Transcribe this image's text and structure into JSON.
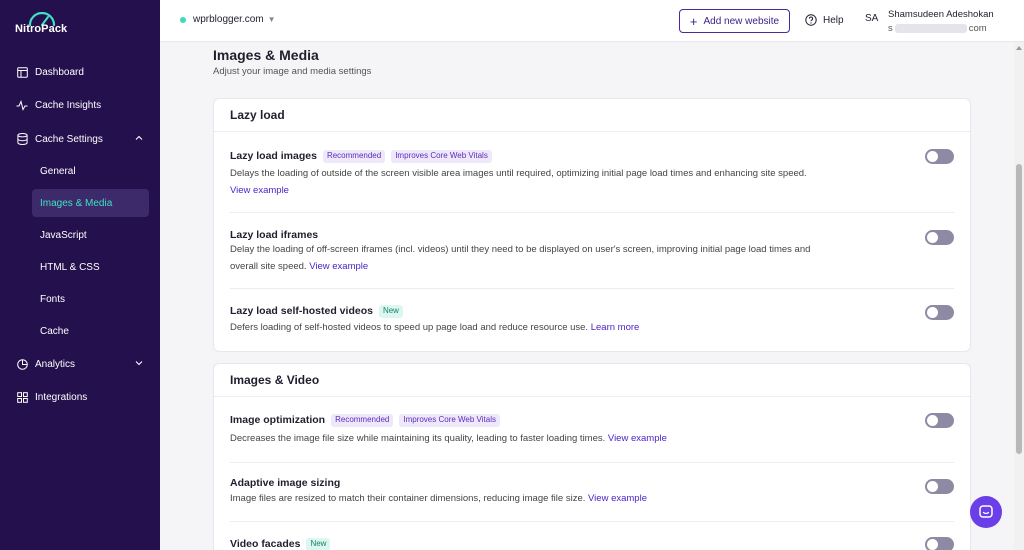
{
  "brand": {
    "name": "NitroPack"
  },
  "sidebar": {
    "items": [
      {
        "label": "Dashboard",
        "icon": "layout-icon"
      },
      {
        "label": "Cache Insights",
        "icon": "pulse-icon"
      },
      {
        "label": "Cache Settings",
        "icon": "database-icon"
      },
      {
        "label": "Analytics",
        "icon": "pie-chart-icon"
      },
      {
        "label": "Integrations",
        "icon": "grid-icon"
      }
    ],
    "sub_items": [
      "General",
      "Images & Media",
      "JavaScript",
      "HTML & CSS",
      "Fonts",
      "Cache"
    ],
    "active_sub": "Images & Media"
  },
  "header": {
    "site": "wprblogger.com",
    "add_button": "Add new website",
    "help": "Help",
    "avatar_initials": "SA",
    "user_name": "Shamsudeen Adeshokan",
    "user_email_start": "s",
    "user_email_end": "com"
  },
  "page": {
    "title": "Images & Media",
    "subtitle": "Adjust your image and media settings"
  },
  "sections": [
    {
      "title": "Lazy load",
      "rows": [
        {
          "title": "Lazy load images",
          "badges": [
            "Recommended",
            "Improves Core Web Vitals"
          ],
          "desc": "Delays the loading of outside of the screen visible area images until required, optimizing initial page load times and enhancing site speed.",
          "link": "View example",
          "enabled": false
        },
        {
          "title": "Lazy load iframes",
          "badges": [],
          "desc": "Delay the loading of off-screen iframes (incl. videos) until they need to be displayed on user's screen, improving initial page load times and overall site speed.",
          "link": "View example",
          "enabled": false
        },
        {
          "title": "Lazy load self-hosted videos",
          "badges": [
            "New"
          ],
          "desc": "Defers loading of self-hosted videos to speed up page load and reduce resource use.",
          "link": "Learn more",
          "enabled": false
        }
      ]
    },
    {
      "title": "Images & Video",
      "rows": [
        {
          "title": "Image optimization",
          "badges": [
            "Recommended",
            "Improves Core Web Vitals"
          ],
          "desc": "Decreases the image file size while maintaining its quality, leading to faster loading times.",
          "link": "View example",
          "enabled": false
        },
        {
          "title": "Adaptive image sizing",
          "badges": [],
          "desc": "Image files are resized to match their container dimensions, reducing image file size.",
          "link": "View example",
          "enabled": false
        },
        {
          "title": "Video facades",
          "badges": [
            "New"
          ],
          "desc": "",
          "link": "",
          "enabled": false
        }
      ]
    }
  ],
  "colors": {
    "sidebar_bg": "#24104d",
    "active_text": "#3fe0c5",
    "accent": "#4a25c9",
    "toggle_off": "#8e8aa3",
    "chat": "#6a3ee8"
  }
}
